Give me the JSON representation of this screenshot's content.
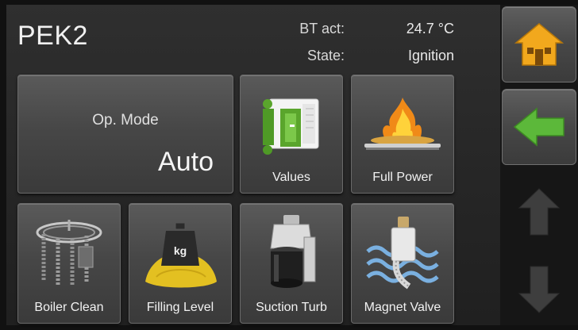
{
  "header": {
    "title": "PEK2",
    "bt_label": "BT act:",
    "bt_value": "24.7 °C",
    "state_label": "State:",
    "state_value": "Ignition"
  },
  "tiles": {
    "op_mode": {
      "label": "Op. Mode",
      "value": "Auto"
    },
    "values": {
      "label": "Values",
      "icon": "values-icon"
    },
    "full_power": {
      "label": "Full Power",
      "icon": "flame-icon"
    },
    "boiler_clean": {
      "label": "Boiler Clean",
      "icon": "boiler-clean-icon"
    },
    "filling_level": {
      "label": "Filling Level",
      "icon": "weight-icon"
    },
    "suction_turb": {
      "label": "Suction Turb",
      "icon": "suction-turbine-icon"
    },
    "magnet_valve": {
      "label": "Magnet Valve",
      "icon": "magnet-valve-icon"
    }
  },
  "sidebar": {
    "home": {
      "icon": "home-icon",
      "color": "#f2a81d"
    },
    "back": {
      "icon": "back-arrow-icon",
      "color": "#5cb83a"
    },
    "up": {
      "icon": "up-arrow-icon"
    },
    "down": {
      "icon": "down-arrow-icon"
    }
  }
}
